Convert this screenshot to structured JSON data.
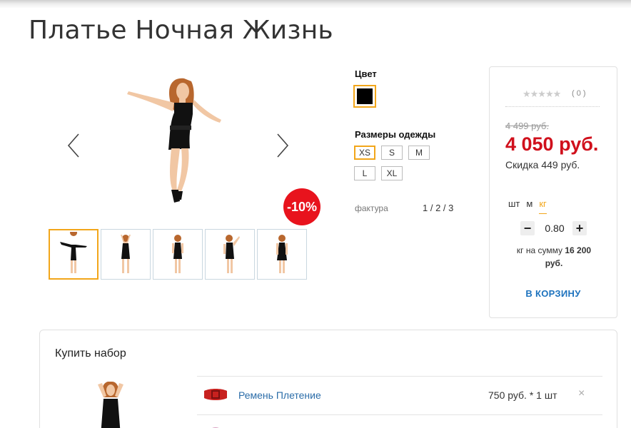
{
  "product": {
    "title": "Платье Ночная Жизнь",
    "discount_badge": "-10%"
  },
  "options": {
    "color_label": "Цвет",
    "selected_color": "#000000",
    "size_label": "Размеры одежды",
    "sizes": [
      "XS",
      "S",
      "M",
      "L",
      "XL"
    ],
    "selected_size": "XS",
    "texture_label": "фактура",
    "texture_pages": "1 / 2 / 3"
  },
  "price": {
    "rating_stars": "★★★★★",
    "rating_count": "( 0 )",
    "old": "4 499 руб.",
    "new": "4 050 руб.",
    "discount": "Скидка 449 руб.",
    "units": [
      "шт",
      "м",
      "кг"
    ],
    "selected_unit": "кг",
    "quantity": "0.80",
    "sum_prefix": "кг на сумму",
    "sum_value": "16 200",
    "sum_suffix": "руб.",
    "cart_button": "В КОРЗИНУ"
  },
  "bundle": {
    "title": "Купить набор",
    "items": [
      {
        "name": "Ремень Плетение",
        "price": "750 руб. * 1 шт",
        "remove": "×"
      }
    ]
  },
  "colors": {
    "accent": "#f2a61a",
    "sale_red": "#d0101c",
    "badge_red": "#e8131d",
    "link_blue": "#1e73be"
  },
  "icons": {
    "prev": "chevron-left-icon",
    "next": "chevron-right-icon",
    "star": "star-icon",
    "remove": "close-icon"
  }
}
